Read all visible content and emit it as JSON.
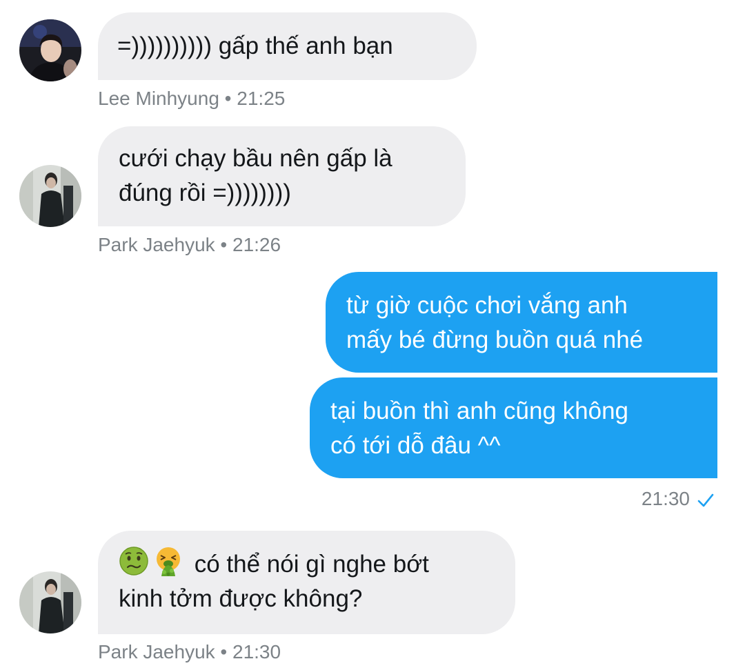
{
  "messages": [
    {
      "sender": "Lee Minhyung",
      "time": "21:25",
      "lines": [
        "=))))))))))  gấp thế anh bạn"
      ],
      "meta": "Lee Minhyung • 21:25"
    },
    {
      "sender": "Park Jaehyuk",
      "time": "21:26",
      "lines": [
        "cưới chạy bầu nên gấp là",
        "đúng rồi =))))))))"
      ],
      "meta": "Park Jaehyuk • 21:26"
    },
    {
      "sender": "me",
      "lines": [
        "từ giờ cuộc chơi vắng anh",
        "mấy bé đừng buồn quá nhé"
      ]
    },
    {
      "sender": "me",
      "lines": [
        "tại buồn thì anh cũng không",
        "có tới dỗ đâu ^^"
      ],
      "time": "21:30",
      "status_icon": "check-icon"
    },
    {
      "sender": "Park Jaehyuk",
      "time": "21:30",
      "emojis": [
        "nauseated-face-emoji",
        "vomiting-face-emoji"
      ],
      "lines": [
        "có thể nói gì nghe bớt",
        "kinh tởm được không?"
      ],
      "meta": "Park Jaehyuk • 21:30"
    }
  ],
  "colors": {
    "incoming_bubble": "#EEEEF0",
    "outgoing_bubble": "#1DA1F2",
    "meta_text": "#7C8287",
    "check": "#1DA1F2"
  }
}
